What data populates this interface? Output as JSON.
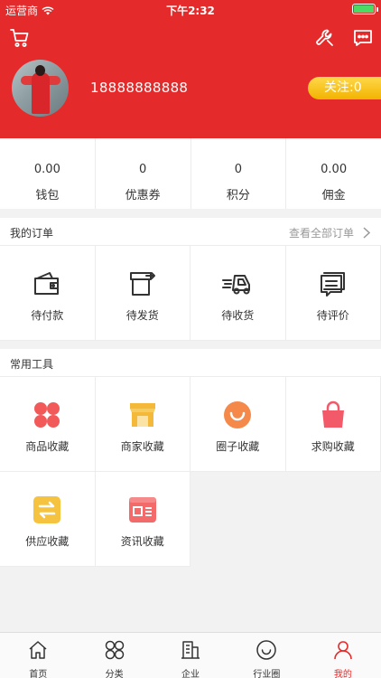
{
  "status_bar": {
    "carrier": "运营商",
    "time": "下午2:32"
  },
  "profile": {
    "phone": "18888888888",
    "follow_label": "关注:0"
  },
  "stats": [
    {
      "value": "0.00",
      "label": "钱包"
    },
    {
      "value": "0",
      "label": "优惠券"
    },
    {
      "value": "0",
      "label": "积分"
    },
    {
      "value": "0.00",
      "label": "佣金"
    }
  ],
  "orders": {
    "title": "我的订单",
    "view_all": "查看全部订单",
    "items": [
      {
        "label": "待付款",
        "icon": "wallet-icon"
      },
      {
        "label": "待发货",
        "icon": "box-send-icon"
      },
      {
        "label": "待收货",
        "icon": "truck-icon"
      },
      {
        "label": "待评价",
        "icon": "comment-icon"
      }
    ]
  },
  "tools": {
    "title": "常用工具",
    "items": [
      {
        "label": "商品收藏",
        "icon": "clover-icon",
        "color": "#f25a5a"
      },
      {
        "label": "商家收藏",
        "icon": "shop-icon",
        "color": "#f5b93a"
      },
      {
        "label": "圈子收藏",
        "icon": "smile-icon",
        "color": "#f5894a"
      },
      {
        "label": "求购收藏",
        "icon": "bag-icon",
        "color": "#f25a6a"
      },
      {
        "label": "供应收藏",
        "icon": "swap-icon",
        "color": "#f5c340"
      },
      {
        "label": "资讯收藏",
        "icon": "news-icon",
        "color": "#f26a6a"
      }
    ]
  },
  "tabbar": [
    {
      "label": "首页",
      "icon": "home-icon"
    },
    {
      "label": "分类",
      "icon": "category-icon"
    },
    {
      "label": "企业",
      "icon": "building-icon"
    },
    {
      "label": "行业圈",
      "icon": "circle-icon"
    },
    {
      "label": "我的",
      "icon": "user-icon",
      "active": true
    }
  ],
  "colors": {
    "brand": "#e42a2a",
    "follow": "#f2b300",
    "battery": "#4cd964"
  }
}
